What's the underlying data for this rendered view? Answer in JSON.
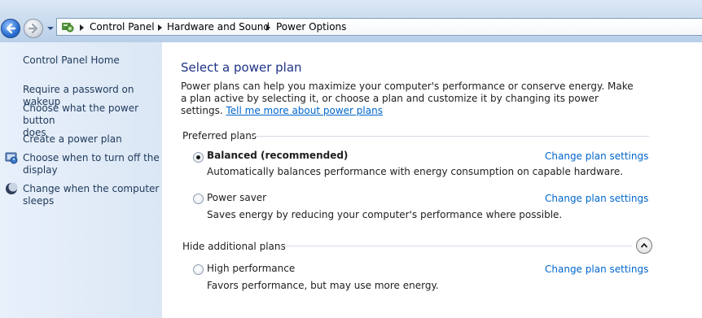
{
  "breadcrumb": [
    "Control Panel",
    "Hardware and Sound",
    "Power Options"
  ],
  "icons": {
    "back": "back-arrow-icon",
    "forward": "forward-arrow-icon",
    "history": "chevron-down-icon",
    "control_panel": "control-panel-icon",
    "power": "power-icon",
    "sleep": "moon-icon",
    "collapse": "chevron-up-icon"
  },
  "sidebar": {
    "home": "Control Panel Home",
    "links": [
      "Require a password on wakeup",
      "Choose what the power button\ndoes",
      "Create a power plan",
      "Choose when to turn off the\ndisplay",
      "Change when the computer\nsleeps"
    ]
  },
  "main": {
    "title": "Select a power plan",
    "description": "Power plans can help you maximize your computer's performance or conserve energy. Make a plan active by selecting it, or choose a plan and customize it by changing its power settings.",
    "more_link": "Tell me more about power plans",
    "preferred_label": "Preferred plans",
    "hide_label": "Hide additional plans",
    "change_label": "Change plan settings",
    "plans": [
      {
        "name": "Balanced (recommended)",
        "desc": "Automatically balances performance with energy consumption on capable hardware.",
        "selected": true
      },
      {
        "name": "Power saver",
        "desc": "Saves energy by reducing your computer's performance where possible.",
        "selected": false
      },
      {
        "name": "High performance",
        "desc": "Favors performance, but may use more energy.",
        "selected": false
      }
    ]
  },
  "colors": {
    "link": "#0066cc",
    "title": "#1e3287",
    "sidebar_link": "#1e395b"
  }
}
